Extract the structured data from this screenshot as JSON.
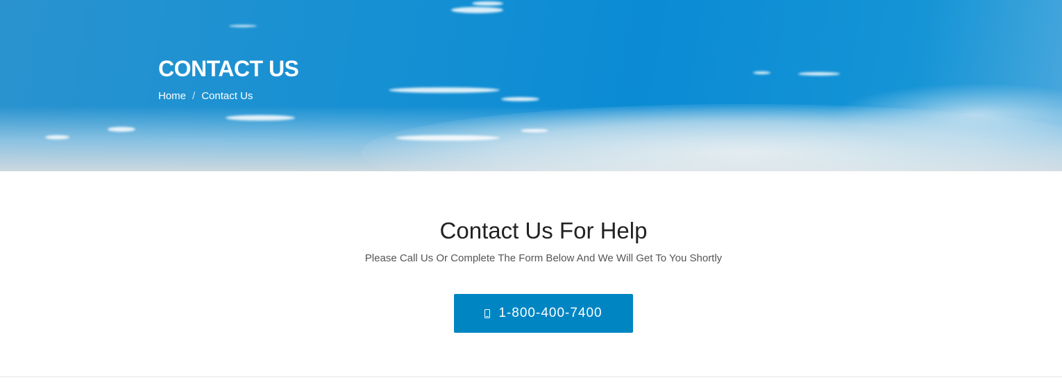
{
  "hero": {
    "title": "CONTACT US",
    "breadcrumb": [
      {
        "label": "Home"
      },
      {
        "label": "Contact Us"
      }
    ],
    "breadcrumb_separator": "/"
  },
  "main": {
    "title": "Contact Us For Help",
    "subtitle": "Please Call Us Or Complete The Form Below And We Will Get To You Shortly",
    "phone_button": {
      "icon": "mobile-phone-icon",
      "label": "1-800-400-7400"
    }
  },
  "colors": {
    "accent": "#0085c3",
    "sky": "#1690d3",
    "heading_text": "#222222",
    "body_text": "#555555"
  }
}
